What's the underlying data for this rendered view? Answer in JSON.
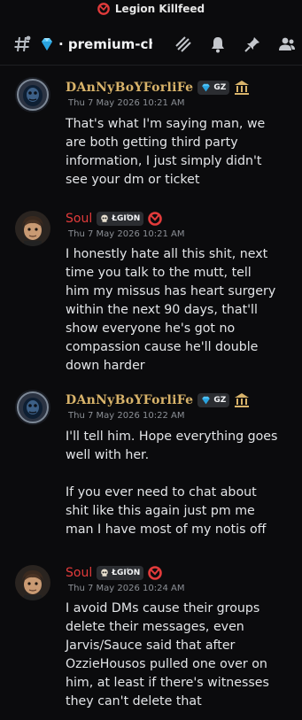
{
  "server": {
    "name": "Legion Killfeed",
    "icon": "legion-logo-icon",
    "accent": "#e23b3b"
  },
  "channel": {
    "name": "premium-chat",
    "display": "· premium-chat",
    "icons": [
      "hash-icon",
      "gem-icon"
    ]
  },
  "toolbar": {
    "icons": [
      "threads-icon",
      "bell-icon",
      "pin-icon",
      "members-icon"
    ]
  },
  "colors": {
    "bg": "#0b0b0d",
    "gold_name": "#d8b36a",
    "red_name": "#e23b3b",
    "text": "#e3e5e8",
    "timestamp": "#8c9096"
  },
  "messages": [
    {
      "author": "DAnNyBoYForliFe",
      "tag": "GZ",
      "tag_icon": "gem-icon",
      "badge": "bank-icon",
      "timestamp": "Thu 7 May 2026 10:21 AM",
      "lines": [
        "That's what I'm saying man, we",
        "are both getting third party",
        "information, I just simply didn't",
        "see your dm or ticket"
      ]
    },
    {
      "author": "Soul",
      "tag": "ŁGIΌN",
      "tag_icon": "skull-icon",
      "badge": "legion-logo-icon",
      "timestamp": "Thu 7 May 2026 10:21 AM",
      "lines": [
        "I honestly hate all this shit, next",
        "time you talk to the mutt, tell",
        "him my missus has heart surgery",
        "within the next 90 days, that'll",
        "show everyone he's got no",
        "compassion cause he'll double",
        "down harder"
      ]
    },
    {
      "author": "DAnNyBoYForliFe",
      "tag": "GZ",
      "tag_icon": "gem-icon",
      "badge": "bank-icon",
      "timestamp": "Thu 7 May 2026 10:22 AM",
      "lines": [
        "I'll tell him. Hope everything goes",
        "well with her.",
        "",
        "If you ever need to chat about",
        "shit like this again just pm me",
        "man I have most of my notis off"
      ]
    },
    {
      "author": "Soul",
      "tag": "ŁGIΌN",
      "tag_icon": "skull-icon",
      "badge": "legion-logo-icon",
      "timestamp": "Thu 7 May 2026 10:24 AM",
      "lines": [
        "I avoid DMs cause their groups",
        "delete their messages, even",
        "Jarvis/Sauce said that after",
        "OzzieHousos pulled one over on",
        "him, at least if there's witnesses",
        "they can't delete that"
      ]
    }
  ]
}
